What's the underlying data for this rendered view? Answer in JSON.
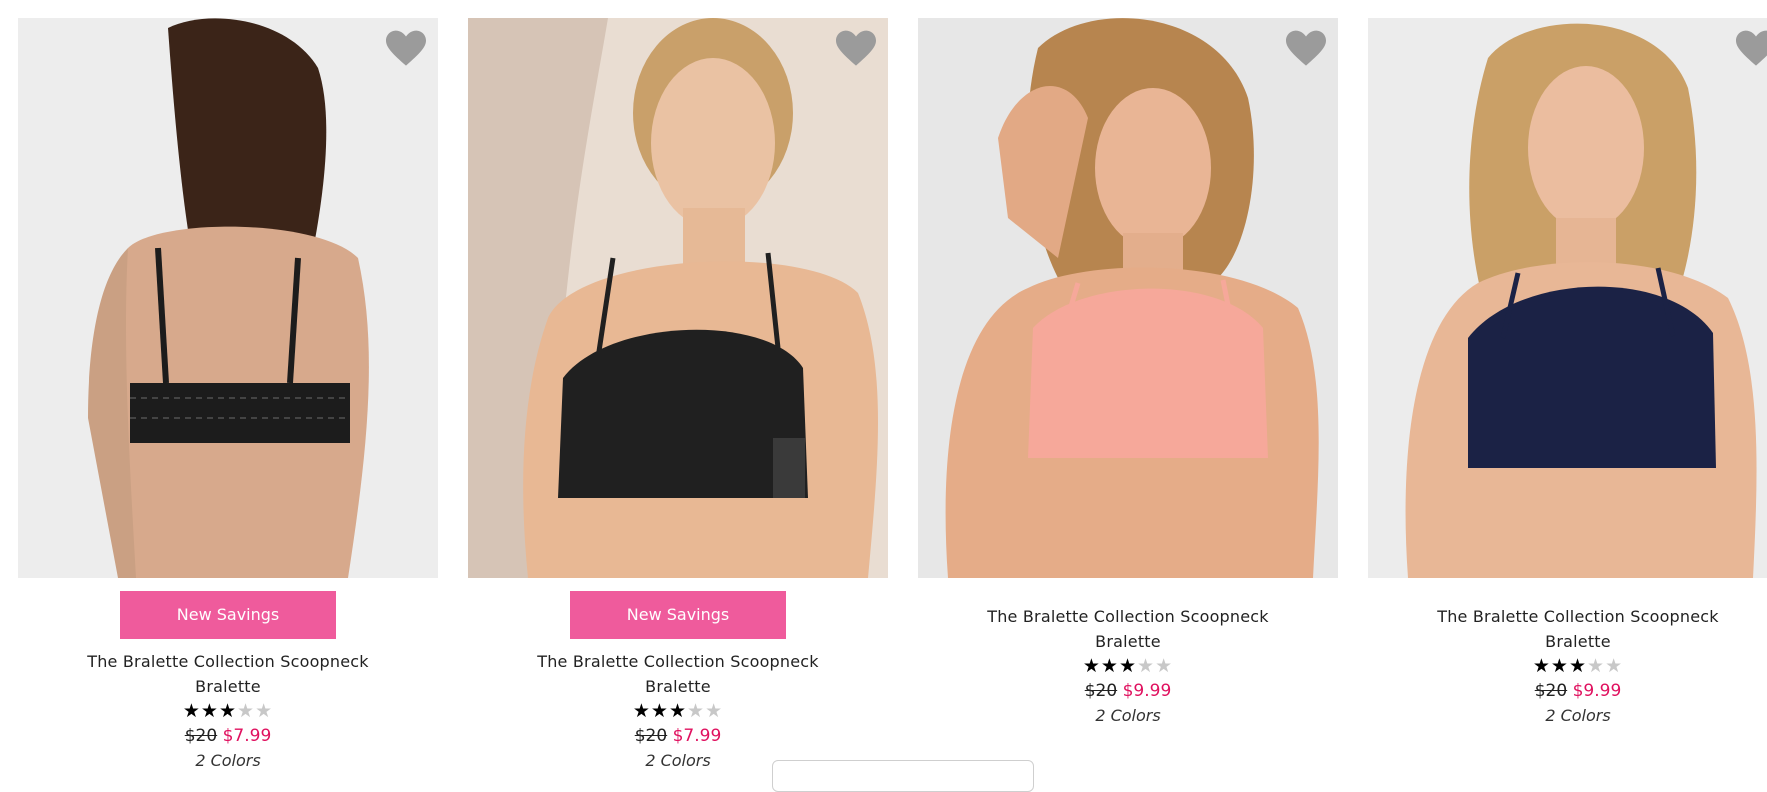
{
  "products": [
    {
      "badge": "New Savings",
      "name_line1": "The Bralette Collection Scoopneck",
      "name_line2": "Bralette",
      "rating": 3.5,
      "stars": "★★★★★",
      "was_price": "$20",
      "now_price": "$7.99",
      "colors": "2 Colors",
      "bra_color": "#1c1c1c",
      "view": "back"
    },
    {
      "badge": "New Savings",
      "name_line1": "The Bralette Collection Scoopneck",
      "name_line2": "Bralette",
      "rating": 3.5,
      "stars": "★★★★★",
      "was_price": "$20",
      "now_price": "$7.99",
      "colors": "2 Colors",
      "bra_color": "#202020",
      "view": "side"
    },
    {
      "badge": "",
      "name_line1": "The Bralette Collection Scoopneck",
      "name_line2": "Bralette",
      "rating": 3,
      "stars": "★★★★★",
      "was_price": "$20",
      "now_price": "$9.99",
      "colors": "2 Colors",
      "bra_color": "#f6a89a",
      "view": "front"
    },
    {
      "badge": "",
      "name_line1": "The Bralette Collection Scoopneck",
      "name_line2": "Bralette",
      "rating": 3.5,
      "stars": "★★★★★",
      "was_price": "$20",
      "now_price": "$9.99",
      "colors": "2 Colors",
      "bra_color": "#1b2245",
      "view": "front"
    }
  ],
  "heart_icon": "heart-icon",
  "colors": {
    "badge": "#ef5b9c",
    "sale_price": "#e0115f",
    "star_on": "#000000",
    "star_off": "#c8c8c8"
  }
}
